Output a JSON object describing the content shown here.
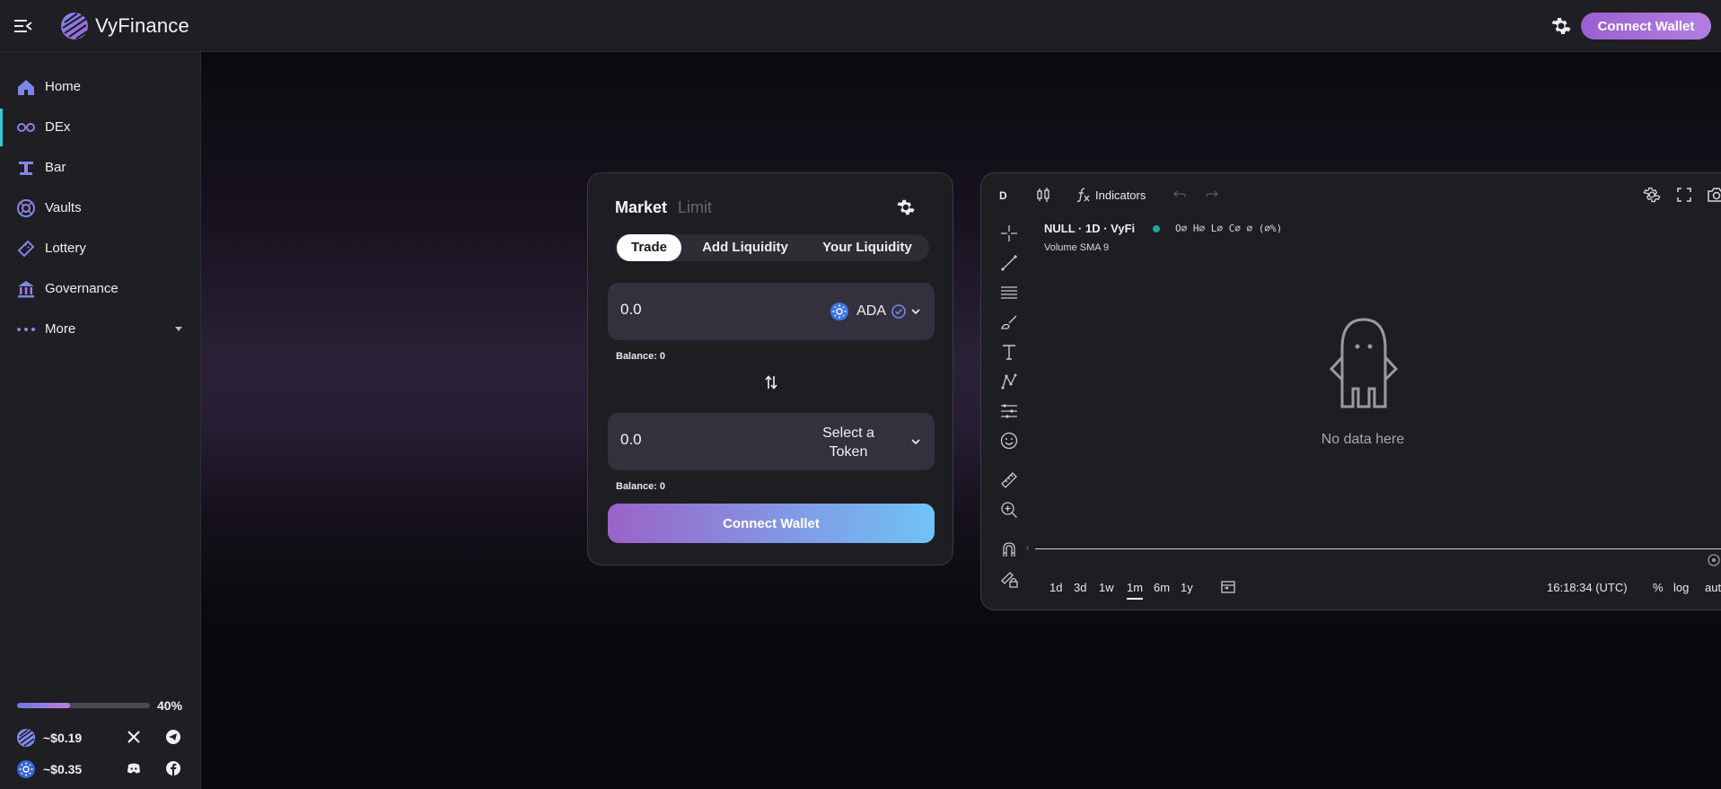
{
  "app": {
    "brand": "VyFinance"
  },
  "header": {
    "connect_label": "Connect Wallet",
    "settings_icon": "gear-icon",
    "menu_icon": "menu-collapse-icon"
  },
  "sidebar": {
    "items": [
      {
        "label": "Home",
        "icon": "home-icon",
        "active": false
      },
      {
        "label": "DEx",
        "icon": "dex-icon",
        "active": true
      },
      {
        "label": "Bar",
        "icon": "bar-icon",
        "active": false
      },
      {
        "label": "Vaults",
        "icon": "vault-icon",
        "active": false
      },
      {
        "label": "Lottery",
        "icon": "ticket-icon",
        "active": false
      },
      {
        "label": "Governance",
        "icon": "governance-icon",
        "active": false
      },
      {
        "label": "More",
        "icon": "more-dots-icon",
        "active": false
      }
    ],
    "progress": {
      "value": 40,
      "label": "40%"
    },
    "prices": [
      {
        "value": "~$0.19",
        "icon": "vyfi-token-icon"
      },
      {
        "value": "~$0.35",
        "icon": "ada-token-icon"
      }
    ],
    "socials": [
      "x-icon",
      "telegram-icon",
      "discord-icon",
      "facebook-icon"
    ]
  },
  "trade": {
    "mode_market": "Market",
    "mode_limit": "Limit",
    "tabs": [
      "Trade",
      "Add Liquidity",
      "Your Liquidity"
    ],
    "from": {
      "amount": "0.0",
      "token": "ADA",
      "balance": "Balance: 0"
    },
    "to": {
      "amount": "0.0",
      "token_placeholder": "Select a Token",
      "balance": "Balance: 0"
    },
    "connect_label": "Connect Wallet"
  },
  "chart": {
    "interval": "D",
    "indicators_label": "Indicators",
    "legend_title": "NULL · 1D · VyFi",
    "legend_ohlc": "O∅ H∅ L∅ C∅ ∅ (∅%)",
    "legend_volume": "Volume SMA 9",
    "empty_text": "No data here",
    "ranges": [
      {
        "label": "1d",
        "active": false
      },
      {
        "label": "3d",
        "active": false
      },
      {
        "label": "1w",
        "active": false
      },
      {
        "label": "1m",
        "active": true
      },
      {
        "label": "6m",
        "active": false
      },
      {
        "label": "1y",
        "active": false
      }
    ],
    "time": "16:18:34 (UTC)",
    "scale": {
      "percent": "%",
      "log": "log",
      "auto": "auto"
    }
  },
  "colors": {
    "accent": "#39c7d6",
    "purple": "#9b5fd0",
    "blue": "#6fc3f8",
    "panel": "#1e1e22"
  }
}
